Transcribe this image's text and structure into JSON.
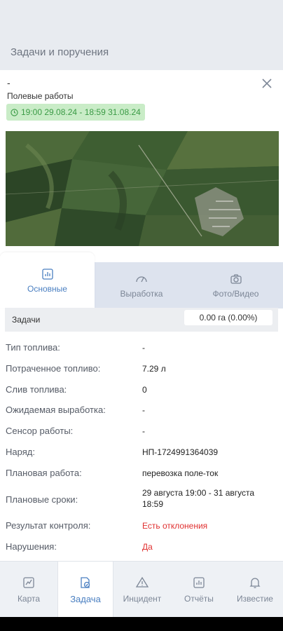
{
  "header": {
    "title": "Задачи и поручения"
  },
  "task": {
    "name": "-",
    "type": "Полевые работы",
    "period": "19:00 29.08.24 - 18:59 31.08.24"
  },
  "tabs": [
    {
      "label": "Основные",
      "icon": "chart-icon",
      "active": true
    },
    {
      "label": "Выработка",
      "icon": "gauge-icon",
      "active": false
    },
    {
      "label": "Фото/Видео",
      "icon": "camera-icon",
      "active": false
    }
  ],
  "tasks_row": {
    "label": "Задачи",
    "value": "0.00 га (0.00%)"
  },
  "details": [
    {
      "label": "Тип топлива:",
      "value": "-"
    },
    {
      "label": "Потраченное топливо:",
      "value": "7.29 л"
    },
    {
      "label": "Слив топлива:",
      "value": "0"
    },
    {
      "label": "Ожидаемая выработка:",
      "value": "-"
    },
    {
      "label": "Сенсор работы:",
      "value": "-"
    },
    {
      "label": "Наряд:",
      "value": "НП-1724991364039"
    },
    {
      "label": "Плановая работа:",
      "value": "перевозка поле-ток"
    },
    {
      "label": "Плановые сроки:",
      "value": "29 августа 19:00 - 31 августа 18:59"
    },
    {
      "label": "Результат контроля:",
      "value": "Есть отклонения",
      "color": "#e03030"
    },
    {
      "label": "Нарушения:",
      "value": "Да",
      "color": "#e03030"
    }
  ],
  "bottom_nav": [
    {
      "label": "Карта",
      "icon": "map-chart-icon",
      "active": false
    },
    {
      "label": "Задача",
      "icon": "task-check-icon",
      "active": true
    },
    {
      "label": "Инцидент",
      "icon": "warning-icon",
      "active": false
    },
    {
      "label": "Отчёты",
      "icon": "report-icon",
      "active": false
    },
    {
      "label": "Известие",
      "icon": "bell-icon",
      "active": false
    }
  ],
  "colors": {
    "accent": "#4a7fc1",
    "success_bg": "#c9ecc7",
    "success_text": "#3a9a45",
    "danger": "#e03030"
  }
}
